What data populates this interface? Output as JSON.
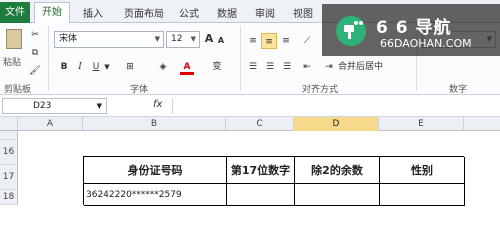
{
  "tabs": [
    "文件",
    "开始",
    "插入",
    "页面布局",
    "公式",
    "数据",
    "审阅",
    "视图"
  ],
  "ribbon": {
    "paste_label": "粘贴",
    "clipboard_label": "剪贴板",
    "font_name": "宋体",
    "font_size": "12",
    "grow_font": "A",
    "shrink_font": "A",
    "bold": "B",
    "italic": "I",
    "underline": "U",
    "font_color_letter": "A",
    "phonetic": "变",
    "font_group_label": "字体",
    "merge_center_label": "合并后居中",
    "alignment_group_label": "对齐方式",
    "number_group_label": "数字"
  },
  "formula_bar": {
    "name_box": "D23",
    "fx_label": "fx",
    "content": ""
  },
  "columns": [
    "A",
    "B",
    "C",
    "D",
    "E"
  ],
  "selected_column": "D",
  "rows": [
    "16",
    "17",
    "18"
  ],
  "table": {
    "headers": [
      "身份证号码",
      "第17位数字",
      "除2的余数",
      "性别"
    ],
    "row1": [
      "36242220******2579",
      "",
      "",
      ""
    ]
  },
  "watermark": {
    "title": "6 6 导航",
    "url": "66DAOHAN.COM"
  },
  "colors": {
    "file_tab": "#1e7c3c",
    "selected_header": "#f6d98a",
    "highlight_button": "#fbe39a"
  }
}
